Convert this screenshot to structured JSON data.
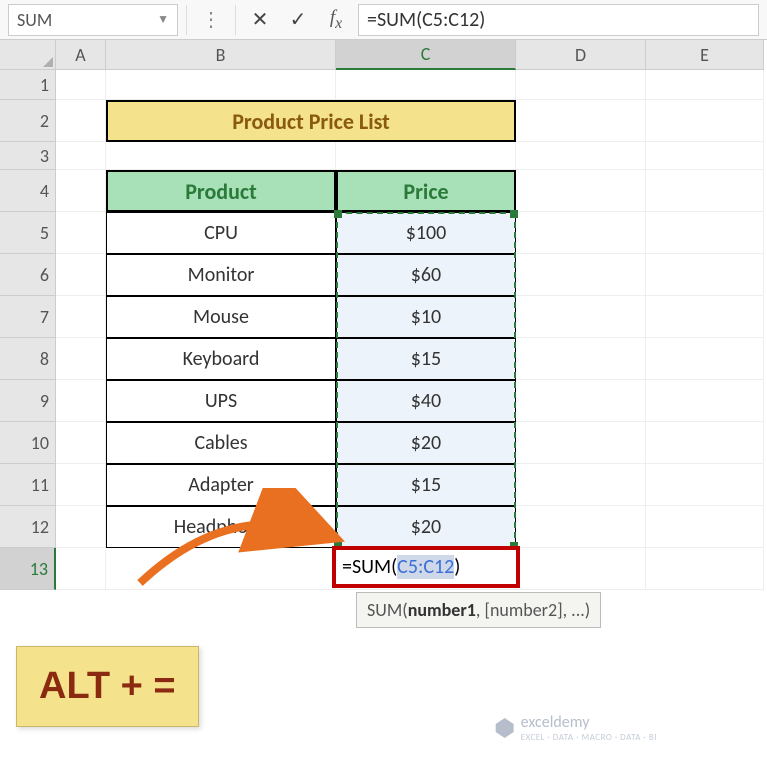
{
  "nameBox": "SUM",
  "formulaBar": "=SUM(C5:C12)",
  "columns": [
    "A",
    "B",
    "C",
    "D",
    "E"
  ],
  "rows": [
    "1",
    "2",
    "3",
    "4",
    "5",
    "6",
    "7",
    "8",
    "9",
    "10",
    "11",
    "12",
    "13"
  ],
  "title": "Product Price List",
  "headers": {
    "product": "Product",
    "price": "Price"
  },
  "data": [
    {
      "product": "CPU",
      "price": "$100"
    },
    {
      "product": "Monitor",
      "price": "$60"
    },
    {
      "product": "Mouse",
      "price": "$10"
    },
    {
      "product": "Keyboard",
      "price": "$15"
    },
    {
      "product": "UPS",
      "price": "$40"
    },
    {
      "product": "Cables",
      "price": "$20"
    },
    {
      "product": "Adapter",
      "price": "$15"
    },
    {
      "product": "Headphone",
      "price": "$20"
    }
  ],
  "editing": {
    "eq": "=",
    "fn": "SUM",
    "open": "(",
    "range": "C5:C12",
    "close": ")"
  },
  "tooltip": {
    "fn": "SUM",
    "arg1": "number1",
    "rest": ", [number2], ...)"
  },
  "callout": "ALT + =",
  "watermark": {
    "name": "exceldemy",
    "tag": "EXCEL · DATA · MACRO · DATA · BI"
  },
  "selectedCol": "C",
  "selectedRow": "13"
}
